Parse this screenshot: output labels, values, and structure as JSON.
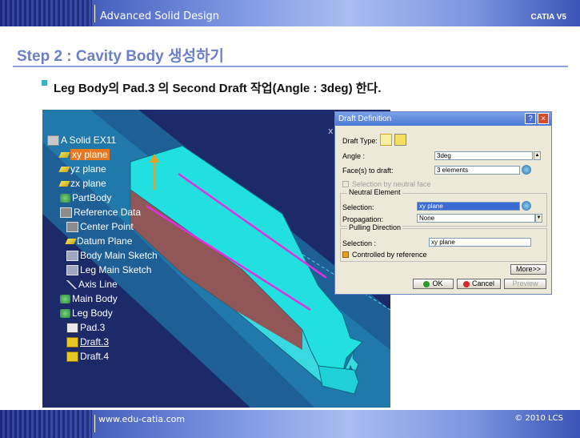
{
  "header": {
    "course": "Advanced Solid Design",
    "product": "CATIA V5"
  },
  "slide": {
    "title": "Step 2 : Cavity Body 생성하기",
    "subtitle": "Leg Body의 Pad.3 의 Second Draft 작업(Angle : 3deg) 한다."
  },
  "viewport": {
    "axis_label": "x"
  },
  "tree": {
    "items": [
      {
        "label": "A Solid EX11",
        "icon": "part-icon"
      },
      {
        "label": "xy plane",
        "icon": "plane-icon",
        "highlighted": true
      },
      {
        "label": "yz plane",
        "icon": "plane-icon"
      },
      {
        "label": "zx plane",
        "icon": "plane-icon"
      },
      {
        "label": "PartBody",
        "icon": "body-icon"
      },
      {
        "label": "Reference Data",
        "icon": "geoset-icon"
      },
      {
        "label": "Center Point",
        "icon": "point-icon"
      },
      {
        "label": "Datum Plane",
        "icon": "plane-icon"
      },
      {
        "label": "Body Main Sketch",
        "icon": "sketch-icon"
      },
      {
        "label": "Leg Main Sketch",
        "icon": "sketch-icon"
      },
      {
        "label": "Axis Line",
        "icon": "line-icon"
      },
      {
        "label": "Main Body",
        "icon": "body-icon"
      },
      {
        "label": "Leg Body",
        "icon": "body-icon"
      },
      {
        "label": "Pad.3",
        "icon": "pad-icon"
      },
      {
        "label": "Draft.3",
        "icon": "draft-icon",
        "underlined": true
      },
      {
        "label": "Draft.4",
        "icon": "draft-icon"
      }
    ]
  },
  "dialog": {
    "title": "Draft Definition",
    "help": "?",
    "close": "×",
    "draft_type_label": "Draft Type:",
    "angle_label": "Angle :",
    "angle_value": "3deg",
    "faces_label": "Face(s) to draft:",
    "faces_value": "3 elements",
    "neutral_face_checkbox": "Selection by neutral face",
    "neutral_group": "Neutral Element",
    "selection_label": "Selection:",
    "selection_value": "xy plane",
    "propagation_label": "Propagation:",
    "propagation_value": "None",
    "pulling_group": "Pulling Direction",
    "pulling_selection_label": "Selection :",
    "pulling_selection_value": "xy plane",
    "controlled_checkbox": "Controlled by reference",
    "more_button": "More>>",
    "ok_button": "OK",
    "cancel_button": "Cancel",
    "preview_button": "Preview"
  },
  "footer": {
    "url": "www.edu-catia.com",
    "copyright": "© 2010 LCS"
  },
  "colors": {
    "title": "#6b80c8",
    "viewport_bg": "#1d2a6a",
    "solid": "#22e0e0",
    "draft_face": "#a04040",
    "pulling_line": "#e030e0",
    "tree_highlight": "#e87820"
  }
}
